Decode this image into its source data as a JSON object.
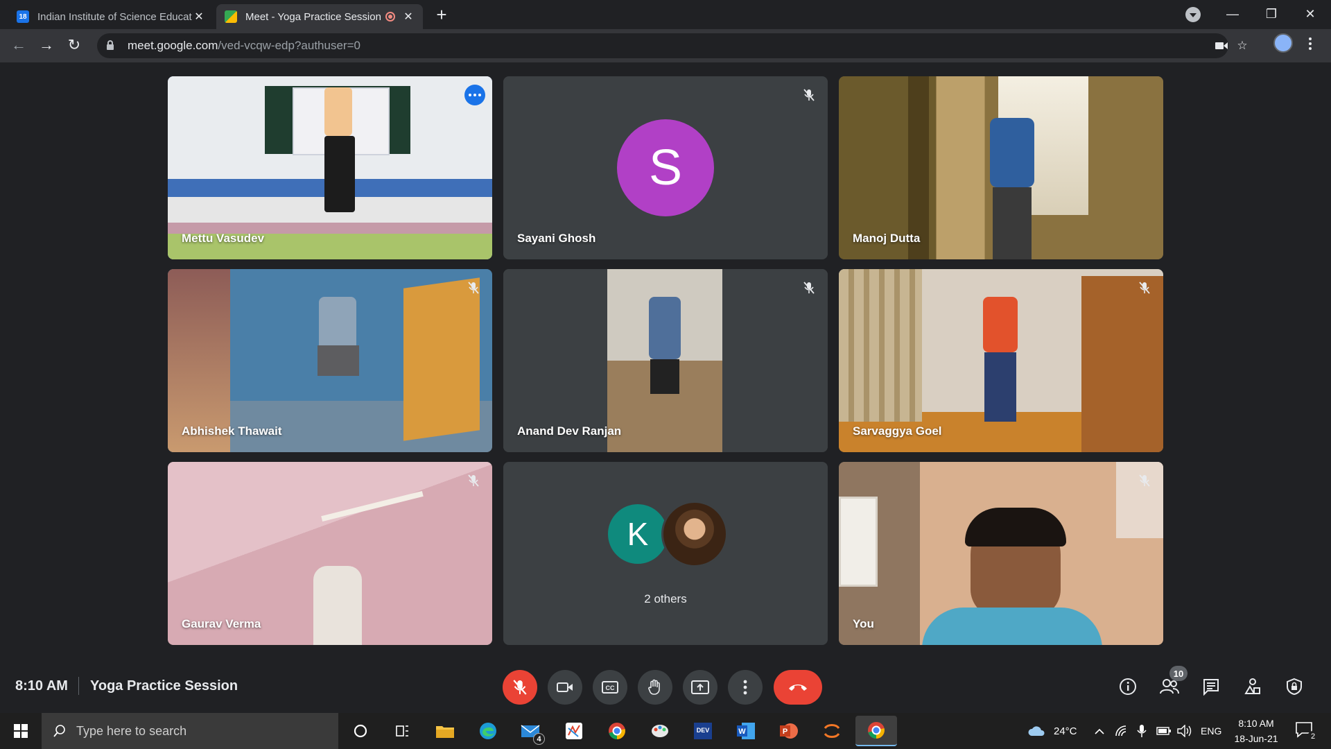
{
  "browser": {
    "tabs": [
      {
        "title": "Indian Institute of Science Educat",
        "favicon": "calendar-icon",
        "favicon_text": "18",
        "active": false
      },
      {
        "title": "Meet - Yoga Practice Session",
        "favicon": "meet-icon",
        "recording": true,
        "active": true
      }
    ],
    "url_host": "meet.google.com",
    "url_path": "/ved-vcqw-edp?authuser=0"
  },
  "meeting": {
    "time": "8:10 AM",
    "title": "Yoga Practice Session",
    "participants_count": "10",
    "tiles": [
      {
        "name": "Mettu Vasudev",
        "muted": false,
        "active_speaker": true
      },
      {
        "name": "Sayani Ghosh",
        "muted": true,
        "initial": "S"
      },
      {
        "name": "Manoj Dutta",
        "muted": false
      },
      {
        "name": "Abhishek Thawait",
        "muted": true
      },
      {
        "name": "Anand Dev Ranjan",
        "muted": true
      },
      {
        "name": "Sarvaggya Goel",
        "muted": true
      },
      {
        "name": "Gaurav Verma",
        "muted": true
      },
      {
        "name": "2 others",
        "initial": "K"
      },
      {
        "name": "You",
        "muted": true
      }
    ]
  },
  "colors": {
    "accent_blue": "#8ab4f8",
    "end_call_red": "#ea4335",
    "avatar_s": "#b140c6",
    "avatar_k": "#0f8a7d"
  },
  "taskbar": {
    "search_placeholder": "Type here to search",
    "mail_badge": "4",
    "weather": "24°C",
    "language": "ENG",
    "time": "8:10 AM",
    "date": "18-Jun-21",
    "notifications": "2"
  }
}
